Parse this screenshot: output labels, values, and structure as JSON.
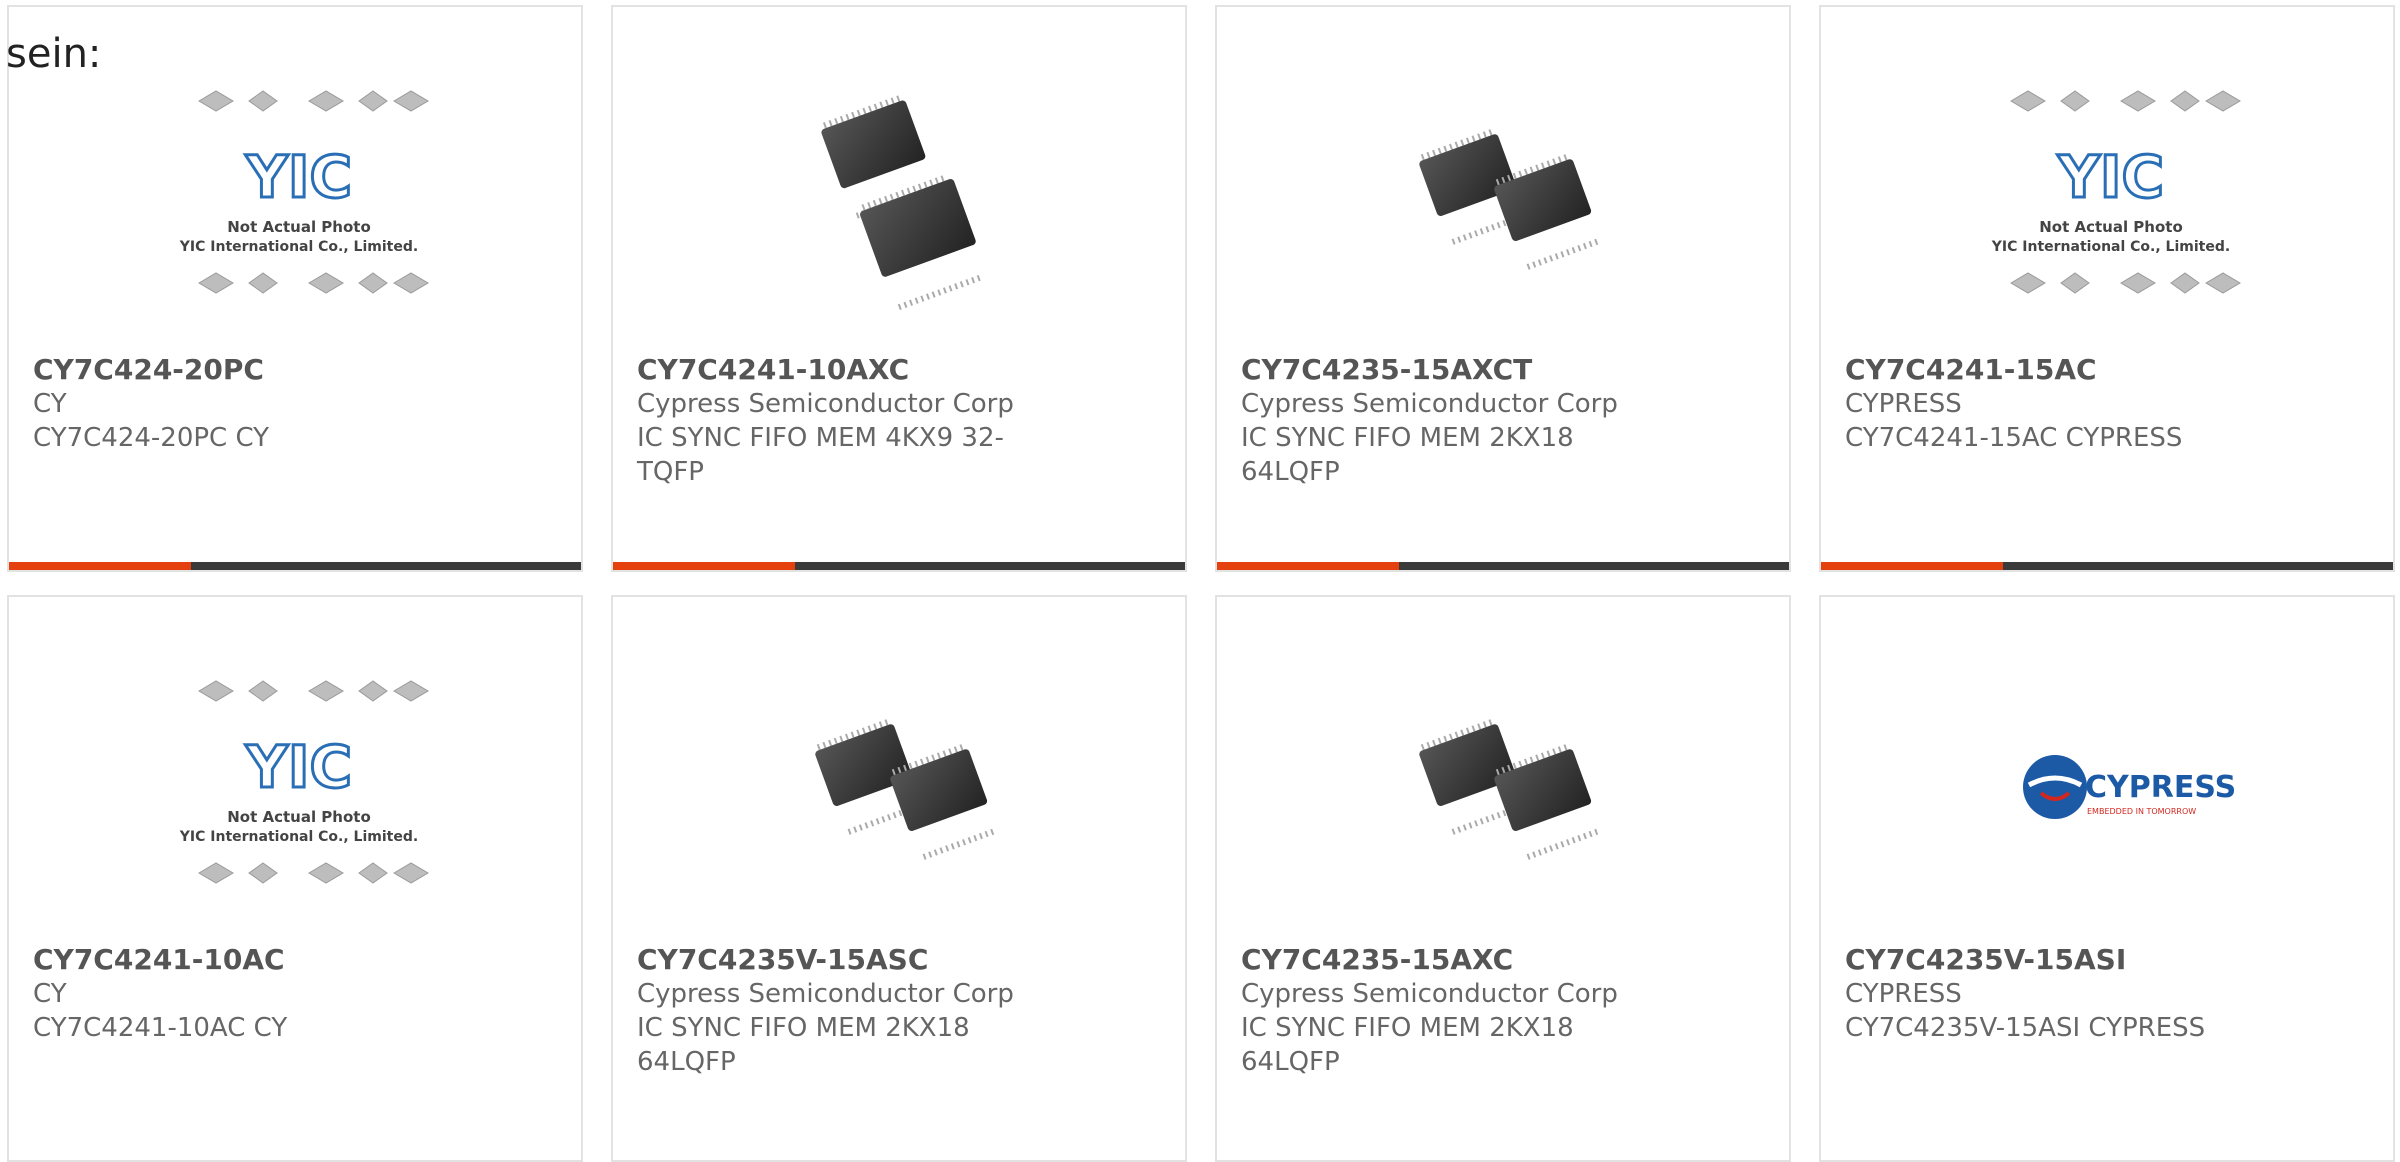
{
  "lead_text": "sein:",
  "placeholder_caption": [
    "Not Actual Photo",
    "YIC International Co., Limited."
  ],
  "logo_text": {
    "brand": "CYPRESS",
    "tagline": "EMBEDDED IN TOMORROW"
  },
  "colors": {
    "accent": "#e5410e",
    "bar": "#3a3a3a",
    "logo_blue": "#1c5aa6",
    "logo_red": "#d1271f"
  },
  "products": [
    {
      "part": "CY7C424-20PC",
      "manufacturer": "CY",
      "description": "CY7C424-20PC CY",
      "image": "yic-placeholder"
    },
    {
      "part": "CY7C4241-10AXC",
      "manufacturer": "Cypress Semiconductor Corp",
      "description": "IC SYNC FIFO MEM 4KX9 32-TQFP",
      "image": "tqfp-chips"
    },
    {
      "part": "CY7C4235-15AXCT",
      "manufacturer": "Cypress Semiconductor Corp",
      "description": "IC SYNC FIFO MEM 2KX18 64LQFP",
      "image": "lqfp-chips"
    },
    {
      "part": "CY7C4241-15AC",
      "manufacturer": "CYPRESS",
      "description": "CY7C4241-15AC CYPRESS",
      "image": "yic-placeholder"
    },
    {
      "part": "CY7C4241-10AC",
      "manufacturer": "CY",
      "description": "CY7C4241-10AC CY",
      "image": "yic-placeholder"
    },
    {
      "part": "CY7C4235V-15ASC",
      "manufacturer": "Cypress Semiconductor Corp",
      "description": "IC SYNC FIFO MEM 2KX18 64LQFP",
      "image": "lqfp-chips"
    },
    {
      "part": "CY7C4235-15AXC",
      "manufacturer": "Cypress Semiconductor Corp",
      "description": "IC SYNC FIFO MEM 2KX18 64LQFP",
      "image": "lqfp-chips"
    },
    {
      "part": "CY7C4235V-15ASI",
      "manufacturer": "CYPRESS",
      "description": "CY7C4235V-15ASI CYPRESS",
      "image": "cypress-logo"
    }
  ]
}
